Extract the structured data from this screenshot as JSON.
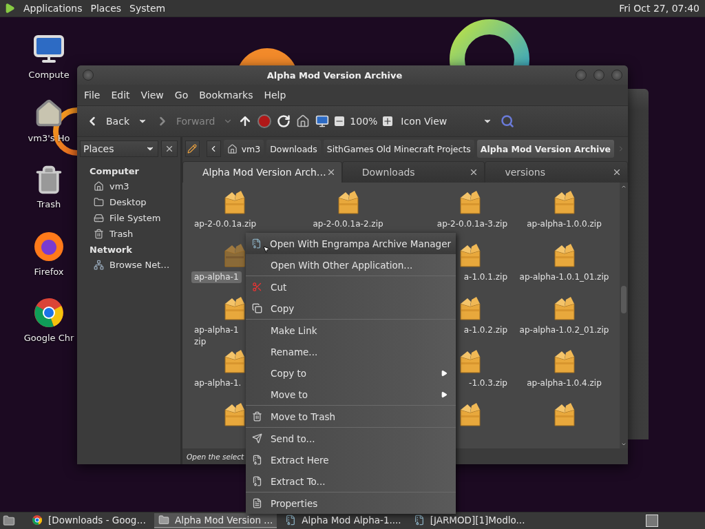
{
  "top_panel": {
    "menus": [
      "Applications",
      "Places",
      "System"
    ],
    "clock": "Fri Oct 27, 07:40"
  },
  "desktop_icons": [
    {
      "kind": "computer",
      "label": "Compute"
    },
    {
      "kind": "home",
      "label": "vm3's Ho"
    },
    {
      "kind": "trash",
      "label": "Trash"
    },
    {
      "kind": "firefox",
      "label": "Firefox"
    },
    {
      "kind": "chrome",
      "label": "Google Chr"
    }
  ],
  "window": {
    "title": "Alpha Mod Version Archive",
    "menu": [
      "File",
      "Edit",
      "View",
      "Go",
      "Bookmarks",
      "Help"
    ],
    "toolbar": {
      "back": "Back",
      "forward": {
        "label": "Forward",
        "disabled": true
      },
      "zoom": "100%",
      "view_mode": "Icon View"
    },
    "sidebar": {
      "title": "Places",
      "sections": [
        {
          "heading": "Computer",
          "items": [
            {
              "label": "vm3",
              "kind": "home"
            },
            {
              "label": "Desktop",
              "kind": "desktop"
            },
            {
              "label": "File System",
              "kind": "drive"
            },
            {
              "label": "Trash",
              "kind": "trash"
            }
          ]
        },
        {
          "heading": "Network",
          "items": [
            {
              "label": "Browse Net…",
              "kind": "network"
            }
          ]
        }
      ]
    },
    "breadcrumbs": [
      {
        "label": "vm3",
        "kind": "home",
        "selected": false
      },
      {
        "label": "Downloads",
        "kind": "plain",
        "selected": false
      },
      {
        "label": "SithGames Old Minecraft Projects",
        "kind": "plain",
        "selected": false
      },
      {
        "label": "Alpha Mod Version Archive",
        "kind": "plain",
        "selected": true
      }
    ],
    "tabs": [
      {
        "label": "Alpha Mod Version Arch…",
        "selected": true
      },
      {
        "label": "Downloads",
        "selected": false
      },
      {
        "label": "versions",
        "selected": false
      }
    ],
    "files": [
      {
        "cells": [
          {
            "kind": "file",
            "label": "ap-2-0.0.1a.zip",
            "selected": false
          },
          {
            "kind": "file",
            "label": "ap-2-0.0.1a-2.zip",
            "selected": false
          },
          {
            "kind": "file",
            "label": "ap-2-0.0.1a-3.zip",
            "selected": false
          },
          {
            "kind": "file",
            "label": "ap-alpha-1.0.0.zip",
            "selected": false
          }
        ]
      },
      {
        "cells": [
          {
            "kind": "file",
            "label": "ap-alpha-1",
            "selected": true
          },
          {
            "kind": "covered"
          },
          {
            "kind": "file",
            "label": "a-1.0.1.zip",
            "selected": false
          },
          {
            "kind": "file",
            "label": "ap-alpha-1.0.1_01.zip",
            "selected": false
          }
        ]
      },
      {
        "cells": [
          {
            "kind": "file",
            "label": "ap-alpha-1\nzip",
            "selected": false
          },
          {
            "kind": "covered"
          },
          {
            "kind": "file",
            "label": "a-1.0.2.zip",
            "selected": false
          },
          {
            "kind": "file",
            "label": "ap-alpha-1.0.2_01.zip",
            "selected": false
          }
        ]
      },
      {
        "cells": [
          {
            "kind": "file",
            "label": "ap-alpha-1.",
            "selected": false
          },
          {
            "kind": "covered"
          },
          {
            "kind": "file",
            "label": "-1.0.3.zip",
            "selected": false
          },
          {
            "kind": "file",
            "label": "ap-alpha-1.0.4.zip",
            "selected": false
          }
        ]
      },
      {
        "cells": [
          {
            "kind": "file",
            "selected": false
          },
          {
            "kind": "covered"
          },
          {
            "kind": "file",
            "selected": false
          },
          {
            "kind": "file",
            "selected": false
          }
        ]
      }
    ],
    "status": "Open the select"
  },
  "context_menu": {
    "sections": [
      [
        {
          "label": "Open With Engrampa Archive Manager",
          "kind": "archive",
          "selected": true
        },
        {
          "label": "Open With Other Application...",
          "kind": "plain",
          "selected": false
        }
      ],
      [
        {
          "label": "Cut",
          "kind": "cut",
          "selected": false
        },
        {
          "label": "Copy",
          "kind": "copy",
          "selected": false
        }
      ],
      [
        {
          "label": "Make Link",
          "kind": "plain",
          "selected": false
        },
        {
          "label": "Rename...",
          "kind": "plain",
          "selected": false
        },
        {
          "label": "Copy to",
          "kind": "submenu",
          "selected": false
        },
        {
          "label": "Move to",
          "kind": "submenu",
          "selected": false
        }
      ],
      [
        {
          "label": "Move to Trash",
          "kind": "trash",
          "selected": false
        }
      ],
      [
        {
          "label": "Send to...",
          "kind": "send",
          "selected": false
        },
        {
          "label": "Extract Here",
          "kind": "extract",
          "selected": false
        },
        {
          "label": "Extract To...",
          "kind": "extract",
          "selected": false
        }
      ],
      [
        {
          "label": "Properties",
          "kind": "properties",
          "selected": false
        }
      ]
    ]
  },
  "taskbar": {
    "tasks": [
      {
        "label": "[Downloads - Goog…",
        "kind": "chrome",
        "selected": false
      },
      {
        "label": "Alpha Mod Version ...",
        "kind": "folder",
        "selected": true
      },
      {
        "label": "Alpha Mod Alpha-1....",
        "kind": "archive",
        "selected": false
      },
      {
        "label": "[JARMOD][1]Modlo...",
        "kind": "archive",
        "selected": false
      }
    ]
  }
}
